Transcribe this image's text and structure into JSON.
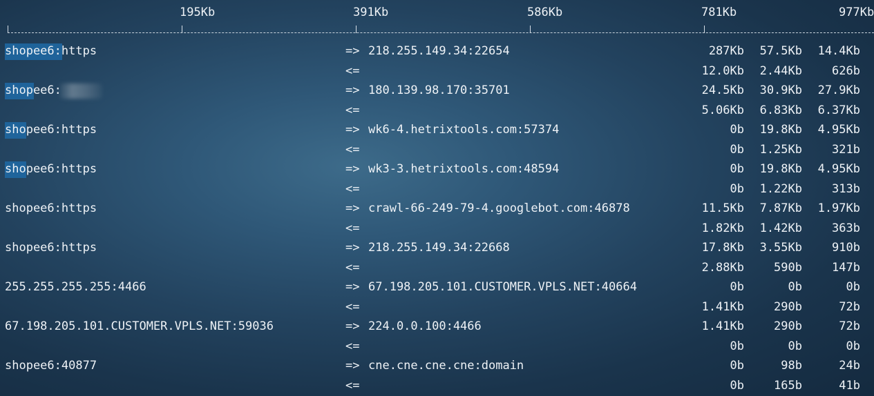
{
  "scale": {
    "labels": [
      "195Kb",
      "391Kb",
      "586Kb",
      "781Kb",
      "977Kb"
    ]
  },
  "connections": [
    {
      "host": "shopee6:https",
      "dest": "218.255.149.34:22654",
      "out": [
        "287Kb",
        "57.5Kb",
        "14.4Kb"
      ],
      "in": [
        "12.0Kb",
        "2.44Kb",
        "626b"
      ]
    },
    {
      "host": "shopee6:",
      "dest": "180.139.98.170:35701",
      "out": [
        "24.5Kb",
        "30.9Kb",
        "27.9Kb"
      ],
      "in": [
        "5.06Kb",
        "6.83Kb",
        "6.37Kb"
      ]
    },
    {
      "host": "shopee6:https",
      "dest": "wk6-4.hetrixtools.com:57374",
      "out": [
        "0b",
        "19.8Kb",
        "4.95Kb"
      ],
      "in": [
        "0b",
        "1.25Kb",
        "321b"
      ]
    },
    {
      "host": "shopee6:https",
      "dest": "wk3-3.hetrixtools.com:48594",
      "out": [
        "0b",
        "19.8Kb",
        "4.95Kb"
      ],
      "in": [
        "0b",
        "1.22Kb",
        "313b"
      ]
    },
    {
      "host": "shopee6:https",
      "dest": "crawl-66-249-79-4.googlebot.com:46878",
      "out": [
        "11.5Kb",
        "7.87Kb",
        "1.97Kb"
      ],
      "in": [
        "1.82Kb",
        "1.42Kb",
        "363b"
      ]
    },
    {
      "host": "shopee6:https",
      "dest": "218.255.149.34:22668",
      "out": [
        "17.8Kb",
        "3.55Kb",
        "910b"
      ],
      "in": [
        "2.88Kb",
        "590b",
        "147b"
      ]
    },
    {
      "host": "255.255.255.255:4466",
      "dest": "67.198.205.101.CUSTOMER.VPLS.NET:40664",
      "out": [
        "0b",
        "0b",
        "0b"
      ],
      "in": [
        "1.41Kb",
        "290b",
        "72b"
      ]
    },
    {
      "host": "67.198.205.101.CUSTOMER.VPLS.NET:59036",
      "dest": "224.0.0.100:4466",
      "out": [
        "1.41Kb",
        "290b",
        "72b"
      ],
      "in": [
        "0b",
        "0b",
        "0b"
      ]
    },
    {
      "host": "shopee6:40877",
      "dest": "cne.cne.cne.cne:domain",
      "out": [
        "0b",
        "98b",
        "24b"
      ],
      "in": [
        "0b",
        "165b",
        "41b"
      ]
    }
  ],
  "arrows": {
    "out": "=>",
    "in": "<="
  },
  "colors": {
    "text": "#eef2f6",
    "selection": "#1e6aa6",
    "background": "#23435f"
  }
}
